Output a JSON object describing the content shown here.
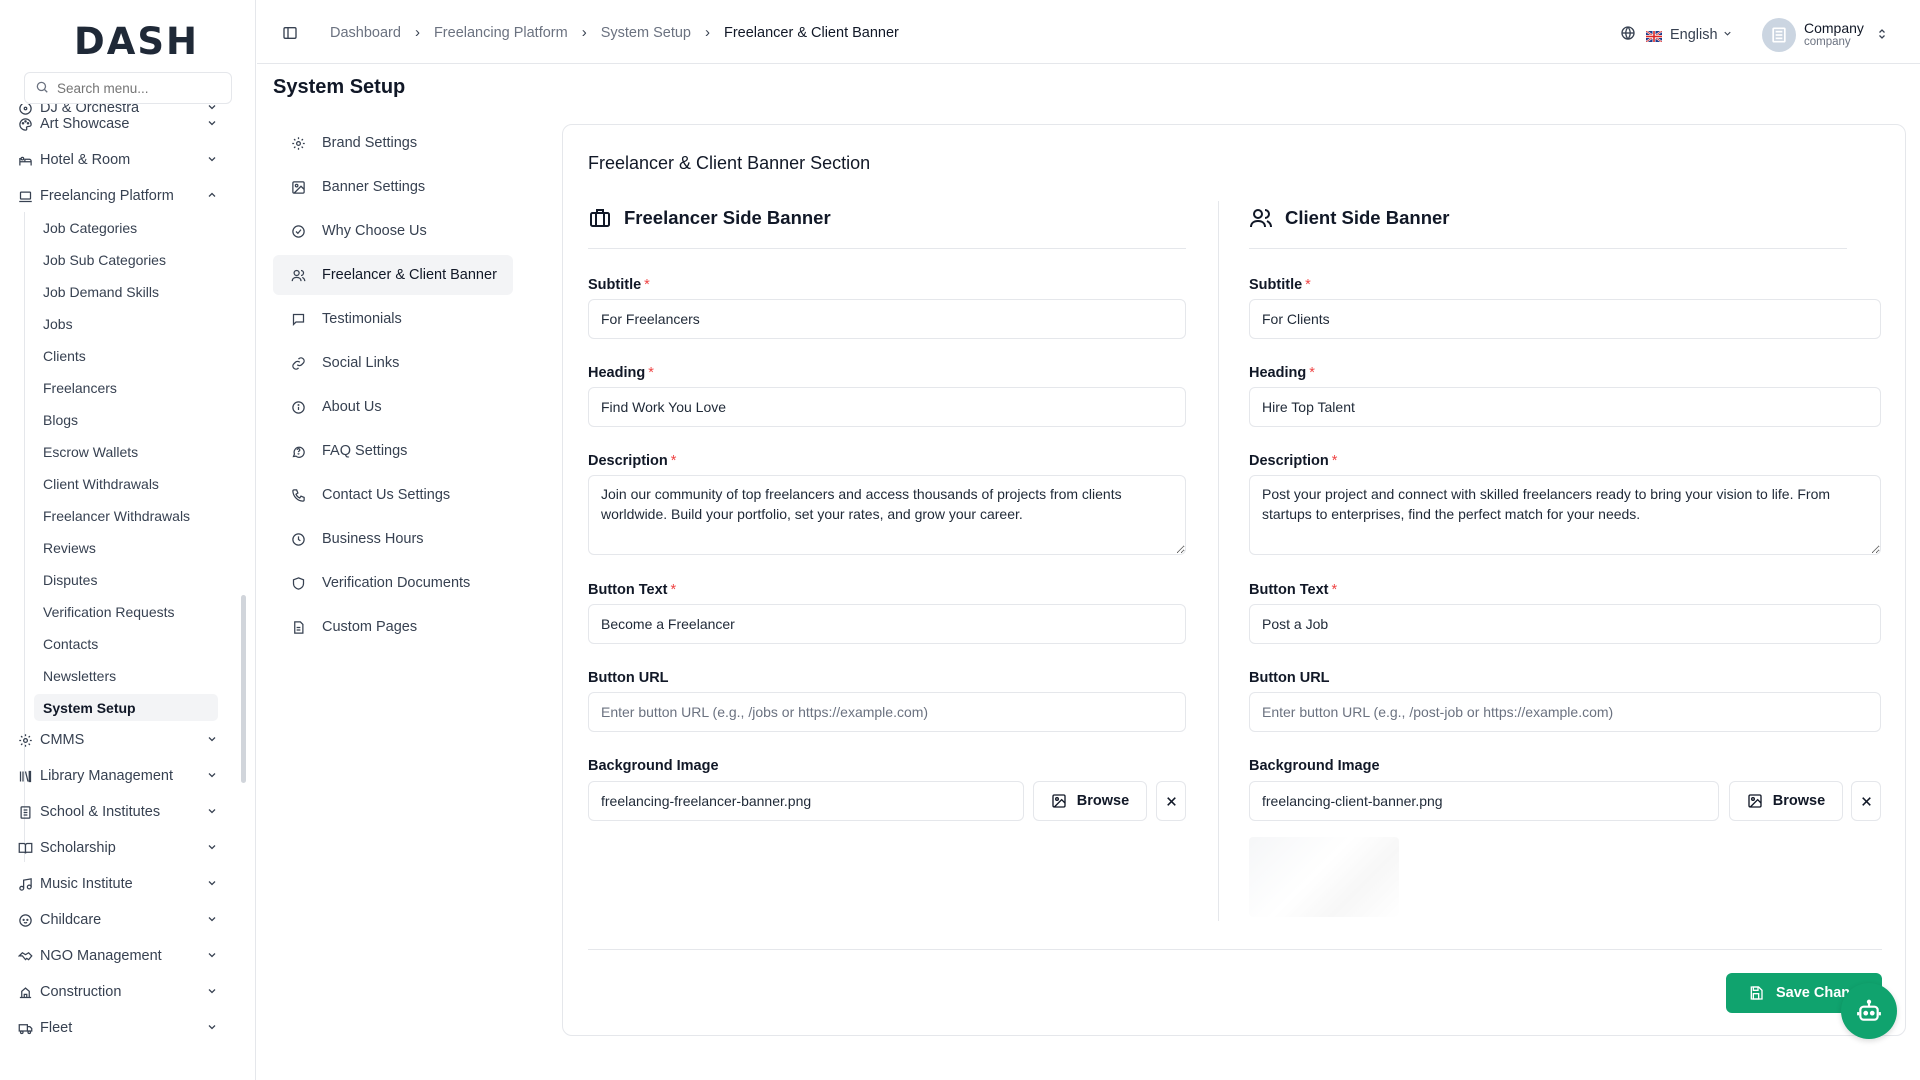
{
  "brand": {
    "logo_text": "DASH",
    "accent_color": "#10a36e"
  },
  "search": {
    "placeholder": "Search menu..."
  },
  "sidebar": {
    "top_items": [
      {
        "label": "DJ & Orchestra",
        "icon": "disc-icon"
      },
      {
        "label": "Art Showcase",
        "icon": "palette-icon"
      },
      {
        "label": "Hotel & Room",
        "icon": "hotel-icon"
      },
      {
        "label": "Freelancing Platform",
        "icon": "laptop-icon",
        "expanded": true
      }
    ],
    "sub_items": [
      "Job Categories",
      "Job Sub Categories",
      "Job Demand Skills",
      "Jobs",
      "Clients",
      "Freelancers",
      "Blogs",
      "Escrow Wallets",
      "Client Withdrawals",
      "Freelancer Withdrawals",
      "Reviews",
      "Disputes",
      "Verification Requests",
      "Contacts",
      "Newsletters",
      "System Setup"
    ],
    "active_sub_item": "System Setup",
    "bottom_items": [
      {
        "label": "CMMS",
        "icon": "gear-icon"
      },
      {
        "label": "Library Management",
        "icon": "library-icon"
      },
      {
        "label": "School & Institutes",
        "icon": "school-icon"
      },
      {
        "label": "Scholarship",
        "icon": "book-open-icon"
      },
      {
        "label": "Music Institute",
        "icon": "music-icon"
      },
      {
        "label": "Childcare",
        "icon": "baby-icon"
      },
      {
        "label": "NGO Management",
        "icon": "handshake-icon"
      },
      {
        "label": "Construction",
        "icon": "construction-icon"
      },
      {
        "label": "Fleet",
        "icon": "truck-icon"
      }
    ]
  },
  "topbar": {
    "breadcrumb": [
      "Dashboard",
      "Freelancing Platform",
      "System Setup",
      "Freelancer & Client Banner"
    ],
    "language": "English",
    "user": {
      "name": "Company",
      "role": "company"
    }
  },
  "page": {
    "title": "System Setup"
  },
  "settings_nav": {
    "items": [
      {
        "label": "Brand Settings",
        "icon": "gear-icon"
      },
      {
        "label": "Banner Settings",
        "icon": "image-icon"
      },
      {
        "label": "Why Choose Us",
        "icon": "check-circle-icon"
      },
      {
        "label": "Freelancer & Client Banner",
        "icon": "users-icon"
      },
      {
        "label": "Testimonials",
        "icon": "message-square-icon"
      },
      {
        "label": "Social Links",
        "icon": "link-icon"
      },
      {
        "label": "About Us",
        "icon": "info-icon"
      },
      {
        "label": "FAQ Settings",
        "icon": "help-circle-icon"
      },
      {
        "label": "Contact Us Settings",
        "icon": "phone-icon"
      },
      {
        "label": "Business Hours",
        "icon": "clock-icon"
      },
      {
        "label": "Verification Documents",
        "icon": "shield-icon"
      },
      {
        "label": "Custom Pages",
        "icon": "file-text-icon"
      }
    ],
    "active": "Freelancer & Client Banner"
  },
  "card": {
    "title": "Freelancer & Client Banner Section",
    "labels": {
      "subtitle": "Subtitle",
      "heading": "Heading",
      "description": "Description",
      "button_text": "Button Text",
      "button_url": "Button URL",
      "background_image": "Background Image",
      "required_mark": "*",
      "browse": "Browse"
    },
    "freelancer": {
      "title": "Freelancer Side Banner",
      "subtitle": "For Freelancers",
      "heading": "Find Work You Love",
      "description": "Join our community of top freelancers and access thousands of projects from clients worldwide. Build your portfolio, set your rates, and grow your career.",
      "button_text": "Become a Freelancer",
      "button_url_placeholder": "Enter button URL (e.g., /jobs or https://example.com)",
      "background_image": "freelancing-freelancer-banner.png"
    },
    "client": {
      "title": "Client Side Banner",
      "subtitle": "For Clients",
      "heading": "Hire Top Talent",
      "description": "Post your project and connect with skilled freelancers ready to bring your vision to life. From startups to enterprises, find the perfect match for your needs.",
      "button_text": "Post a Job",
      "button_url_placeholder": "Enter button URL (e.g., /post-job or https://example.com)",
      "background_image": "freelancing-client-banner.png"
    },
    "save_label": "Save Changes"
  }
}
